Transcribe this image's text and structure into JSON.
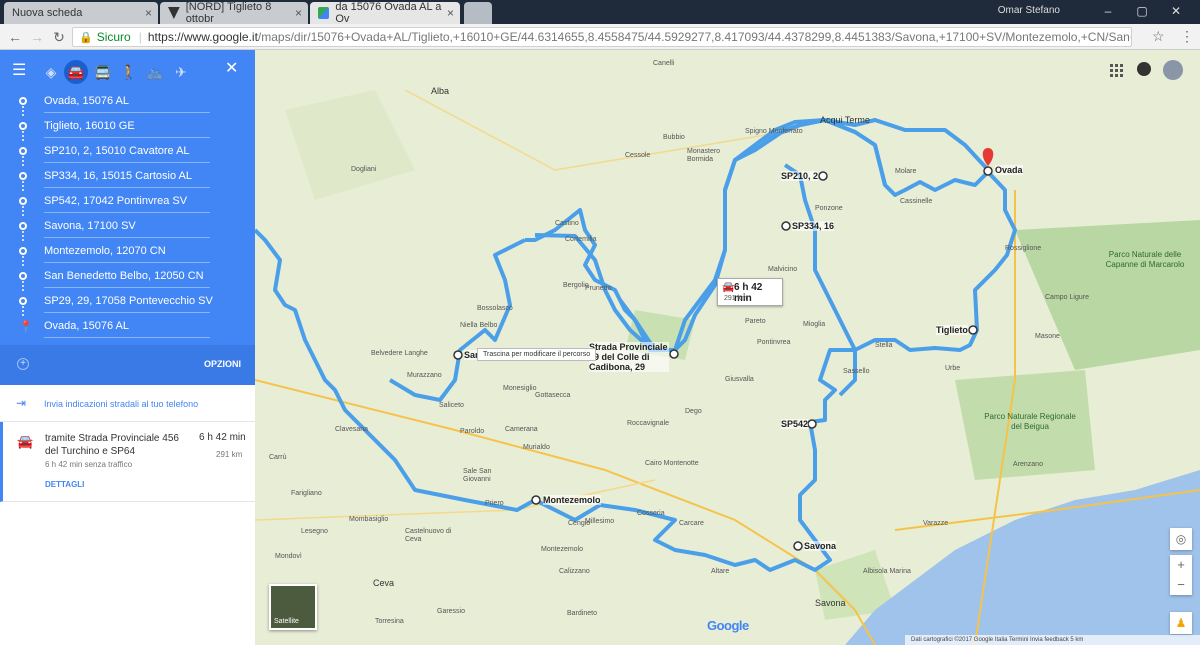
{
  "browser": {
    "tabs": [
      {
        "title": "Nuova scheda"
      },
      {
        "title": "[NORD] Tiglieto 8 ottobr"
      },
      {
        "title": "da 15076 Ovada AL a Ov"
      }
    ],
    "user": "Omar Stefano",
    "secure_label": "Sicuro",
    "url_host": "https://www.google.it",
    "url_path": "/maps/dir/15076+Ovada+AL/Tiglieto,+16010+GE/44.6314655,8.4558475/44.5929277,8.417093/44.4378299,8.4451383/Savona,+17100+SV/Montezemolo,+CN/San+Benedetto+Belbo..."
  },
  "panel": {
    "stops": [
      {
        "label": "Ovada, 15076 AL"
      },
      {
        "label": "Tiglieto, 16010 GE"
      },
      {
        "label": "SP210, 2, 15010 Cavatore AL"
      },
      {
        "label": "SP334, 16, 15015 Cartosio AL"
      },
      {
        "label": "SP542, 17042 Pontinvrea SV"
      },
      {
        "label": "Savona, 17100 SV"
      },
      {
        "label": "Montezemolo, 12070 CN"
      },
      {
        "label": "San Benedetto Belbo, 12050 CN"
      },
      {
        "label": "SP29, 29, 17058 Pontevecchio SV"
      },
      {
        "label": "Ovada, 15076 AL"
      }
    ],
    "options_label": "OPZIONI",
    "send_label": "Invia indicazioni stradali al tuo telefono",
    "route": {
      "name": "tramite Strada Provinciale 456 del Turchino e SP64",
      "time": "6 h 42 min",
      "distance": "291 km",
      "traffic": "6 h 42 min senza traffico",
      "details_label": "DETTAGLI"
    }
  },
  "map": {
    "time_box": {
      "time": "6 h 42 min",
      "km": "291 km"
    },
    "tooltip": "Trascina per modificare il percorso",
    "waypoints": [
      "Ovada",
      "Tiglieto",
      "SP210, 2",
      "SP334, 16",
      "SP542",
      "Savona",
      "Montezemolo",
      "San",
      "Strada Provinciale 29 del Colle di Cadibona, 29"
    ],
    "places": [
      "Acqui Terme",
      "Alba",
      "Canelli",
      "Cortemilia",
      "Bergolio",
      "Pareto",
      "Mioglia",
      "Sassello",
      "Albisola Marina",
      "Varazze",
      "Arenzano",
      "Cairo Montenotte",
      "Dego",
      "Cengio",
      "Millesimo",
      "Cosseria",
      "Carcare",
      "Altare",
      "Savona",
      "Ceva",
      "Murazzano",
      "Dogliani",
      "Bossolasco",
      "Monesiglio",
      "Gottasecca",
      "Prunetto",
      "Castino",
      "Bubbio",
      "Cessole",
      "Monastero Bormida",
      "Spigno Monferrato",
      "Malvicino",
      "Ponzone",
      "Cassinelle",
      "Molare",
      "Rossiglione",
      "Campo Ligure",
      "Masone",
      "Urbe",
      "Stella",
      "Pontinvrea",
      "Giusvalla",
      "Roccavignale",
      "Murialdo",
      "Calizzano",
      "Bardineto",
      "Garessio",
      "Mondovì",
      "Clavesana",
      "Carrù",
      "Farigliano",
      "Belvedere Langhe",
      "Niella Belbo",
      "Saliceto",
      "Camerana",
      "Paroldo",
      "Sale San Giovanni",
      "Priero",
      "Montezemolo",
      "Castelnuovo di Ceva",
      "Mombasiglio",
      "Lesegno",
      "Torresina"
    ],
    "parks": [
      {
        "name": "Parco Naturale delle Capanne di Marcarolo"
      },
      {
        "name": "Parco Naturale Regionale del Beigua"
      }
    ],
    "satellite_label": "Satellite",
    "google_label": "Google",
    "footer": "Dati cartografici ©2017 Google   Italia   Termini   Invia feedback   5 km"
  }
}
